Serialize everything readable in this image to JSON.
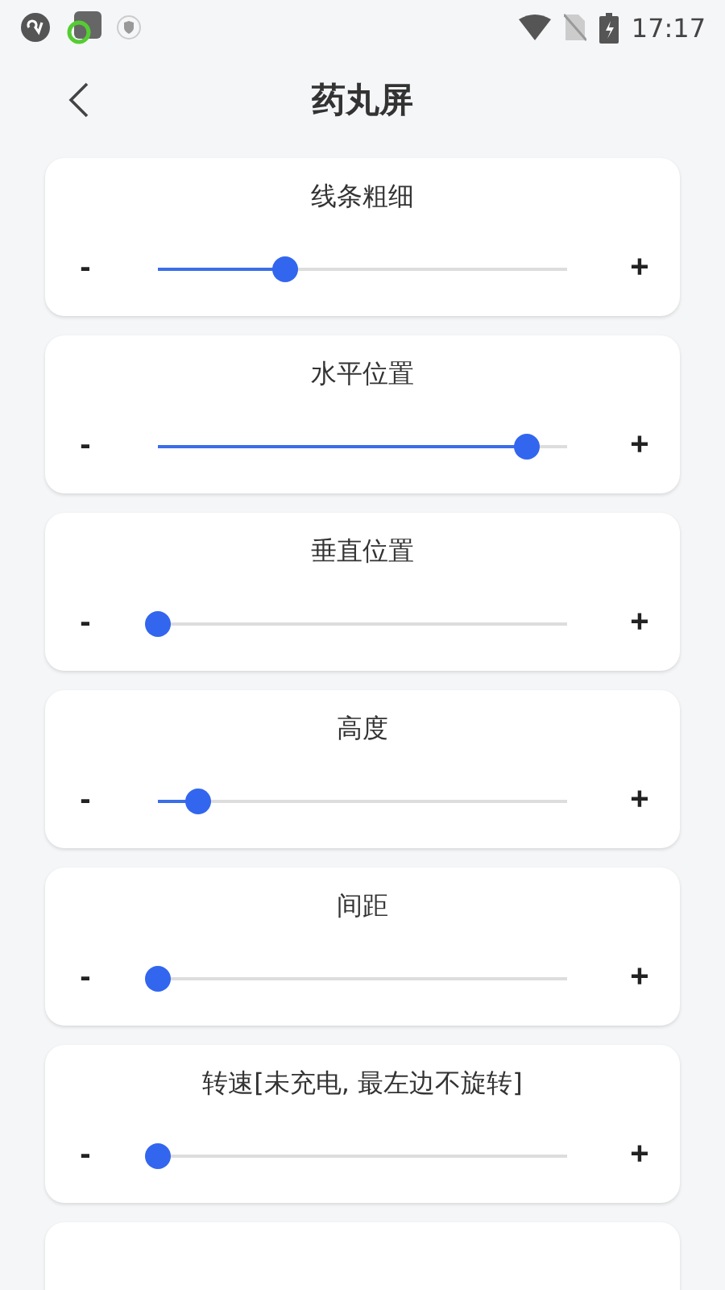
{
  "status_bar": {
    "time": "17:17"
  },
  "header": {
    "title": "药丸屏"
  },
  "sliders": [
    {
      "label": "线条粗细",
      "minus": "-",
      "plus": "+",
      "level": 0.31
    },
    {
      "label": "水平位置",
      "minus": "-",
      "plus": "+",
      "level": 0.9
    },
    {
      "label": "垂直位置",
      "minus": "-",
      "plus": "+",
      "level": 0
    },
    {
      "label": "高度",
      "minus": "-",
      "plus": "+",
      "level": 0.1
    },
    {
      "label": "间距",
      "minus": "-",
      "plus": "+",
      "level": 0
    },
    {
      "label": "转速[未充电, 最左边不旋转]",
      "minus": "-",
      "plus": "+",
      "level": 0
    }
  ]
}
